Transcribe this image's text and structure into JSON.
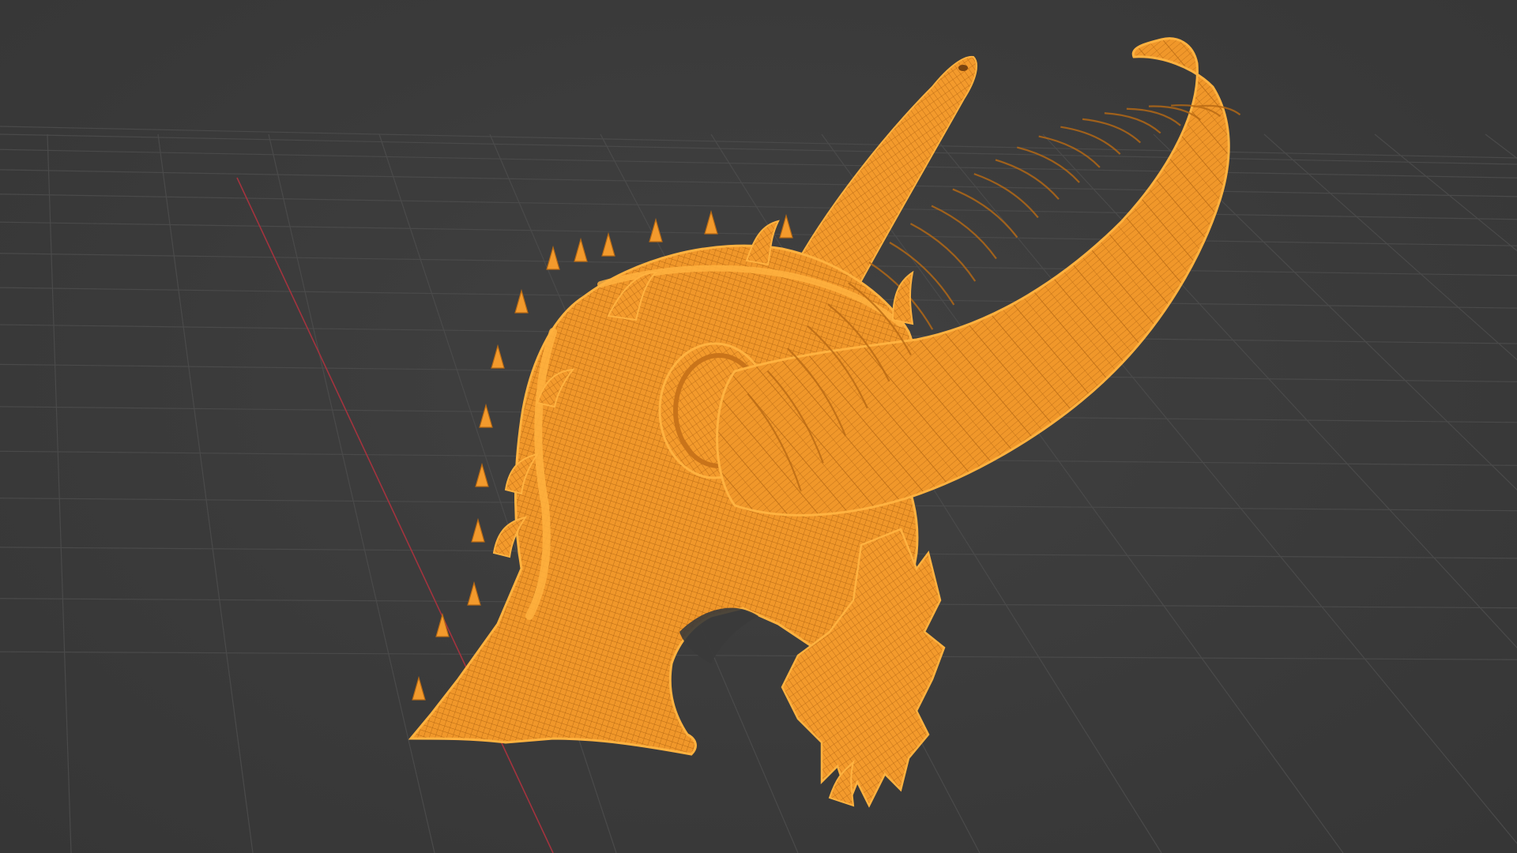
{
  "app": {
    "name": "3D viewport",
    "mode": "wireframe"
  },
  "viewport": {
    "background_color": "#3a3a3a",
    "grid_color": "#4a4a4a",
    "x_axis_color": "#a3333e",
    "object": {
      "name": "helmet-mesh-icon",
      "fill_color": "#f0972a",
      "wire_color": "#b86a14",
      "edge_color": "#ffb240",
      "selected": true
    }
  }
}
